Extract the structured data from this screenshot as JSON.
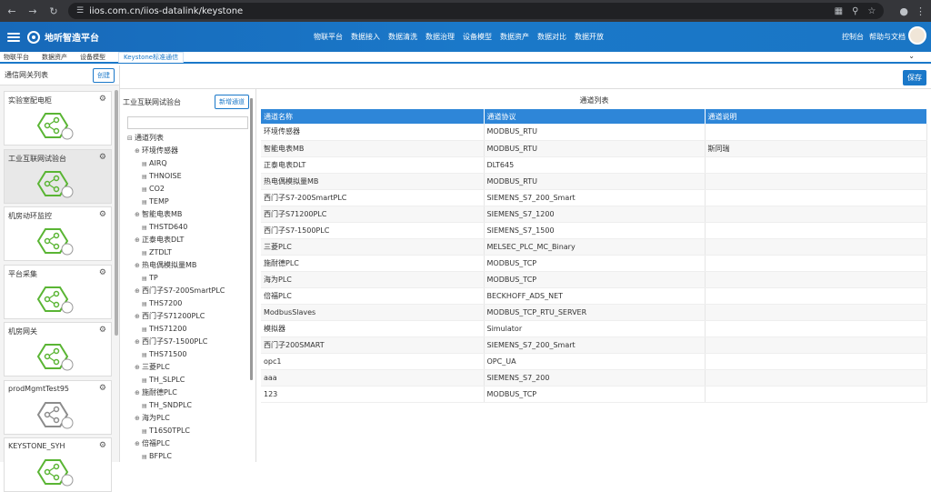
{
  "browser": {
    "url": "iios.com.cn/iios-datalink/keystone"
  },
  "app": {
    "brand": "地听智造平台",
    "menu": [
      "物联平台",
      "数据接入",
      "数据清洗",
      "数据治理",
      "设备模型",
      "数据资产",
      "数据对比",
      "数据开放"
    ],
    "right": [
      "控制台",
      "帮助与文档"
    ]
  },
  "tabs": {
    "items": [
      "物联平台",
      "数据资产",
      "设备模型",
      "Keystone标准通信"
    ]
  },
  "left": {
    "title": "通信网关列表",
    "create_label": "创建",
    "cards": [
      {
        "title": "实验室配电柜",
        "color": "#5ab534"
      },
      {
        "title": "工业互联网试验台",
        "color": "#5ab534"
      },
      {
        "title": "机房动环监控",
        "color": "#5ab534"
      },
      {
        "title": "平台采集",
        "color": "#5ab534"
      },
      {
        "title": "机房网关",
        "color": "#5ab534"
      },
      {
        "title": "prodMgmtTest95",
        "color": "#8c8c8c"
      },
      {
        "title": "KEYSTONE_SYH",
        "color": "#5ab534"
      }
    ]
  },
  "middle": {
    "title": "工业互联网试验台",
    "add_label": "新增通道",
    "tree": [
      {
        "level": 0,
        "label": "通道列表",
        "type": "root"
      },
      {
        "level": 1,
        "label": "环境传感器",
        "type": "node"
      },
      {
        "level": 2,
        "label": "AIRQ",
        "type": "leaf"
      },
      {
        "level": 2,
        "label": "THNOISE",
        "type": "leaf"
      },
      {
        "level": 2,
        "label": "CO2",
        "type": "leaf"
      },
      {
        "level": 2,
        "label": "TEMP",
        "type": "leaf"
      },
      {
        "level": 1,
        "label": "智能电表MB",
        "type": "node"
      },
      {
        "level": 2,
        "label": "THSTD640",
        "type": "leaf"
      },
      {
        "level": 1,
        "label": "正泰电表DLT",
        "type": "node"
      },
      {
        "level": 2,
        "label": "ZTDLT",
        "type": "leaf"
      },
      {
        "level": 1,
        "label": "热电偶模拟量MB",
        "type": "node"
      },
      {
        "level": 2,
        "label": "TP",
        "type": "leaf"
      },
      {
        "level": 1,
        "label": "西门子S7-200SmartPLC",
        "type": "node"
      },
      {
        "level": 2,
        "label": "THS7200",
        "type": "leaf"
      },
      {
        "level": 1,
        "label": "西门子S71200PLC",
        "type": "node"
      },
      {
        "level": 2,
        "label": "THS71200",
        "type": "leaf"
      },
      {
        "level": 1,
        "label": "西门子S7-1500PLC",
        "type": "node"
      },
      {
        "level": 2,
        "label": "THS71500",
        "type": "leaf"
      },
      {
        "level": 1,
        "label": "三菱PLC",
        "type": "node"
      },
      {
        "level": 2,
        "label": "TH_SLPLC",
        "type": "leaf"
      },
      {
        "level": 1,
        "label": "施耐德PLC",
        "type": "node"
      },
      {
        "level": 2,
        "label": "TH_SNDPLC",
        "type": "leaf"
      },
      {
        "level": 1,
        "label": "海为PLC",
        "type": "node"
      },
      {
        "level": 2,
        "label": "T16S0TPLC",
        "type": "leaf"
      },
      {
        "level": 1,
        "label": "倍福PLC",
        "type": "node"
      },
      {
        "level": 2,
        "label": "BFPLC",
        "type": "leaf"
      }
    ]
  },
  "save_label": "保存",
  "table": {
    "title": "通道列表",
    "headers": [
      "通道名称",
      "通道协议",
      "通道说明"
    ],
    "rows": [
      [
        "环境传感器",
        "MODBUS_RTU",
        ""
      ],
      [
        "智能电表MB",
        "MODBUS_RTU",
        "斯同瑞"
      ],
      [
        "正泰电表DLT",
        "DLT645",
        ""
      ],
      [
        "热电偶模拟量MB",
        "MODBUS_RTU",
        ""
      ],
      [
        "西门子S7-200SmartPLC",
        "SIEMENS_S7_200_Smart",
        ""
      ],
      [
        "西门子S71200PLC",
        "SIEMENS_S7_1200",
        ""
      ],
      [
        "西门子S7-1500PLC",
        "SIEMENS_S7_1500",
        ""
      ],
      [
        "三菱PLC",
        "MELSEC_PLC_MC_Binary",
        ""
      ],
      [
        "施耐德PLC",
        "MODBUS_TCP",
        ""
      ],
      [
        "海为PLC",
        "MODBUS_TCP",
        ""
      ],
      [
        "倍福PLC",
        "BECKHOFF_ADS_NET",
        ""
      ],
      [
        "ModbusSlaves",
        "MODBUS_TCP_RTU_SERVER",
        ""
      ],
      [
        "模拟器",
        "Simulator",
        ""
      ],
      [
        "西门子200SMART",
        "SIEMENS_S7_200_Smart",
        ""
      ],
      [
        "opc1",
        "OPC_UA",
        ""
      ],
      [
        "aaa",
        "SIEMENS_S7_200",
        ""
      ],
      [
        "123",
        "MODBUS_TCP",
        ""
      ]
    ]
  }
}
